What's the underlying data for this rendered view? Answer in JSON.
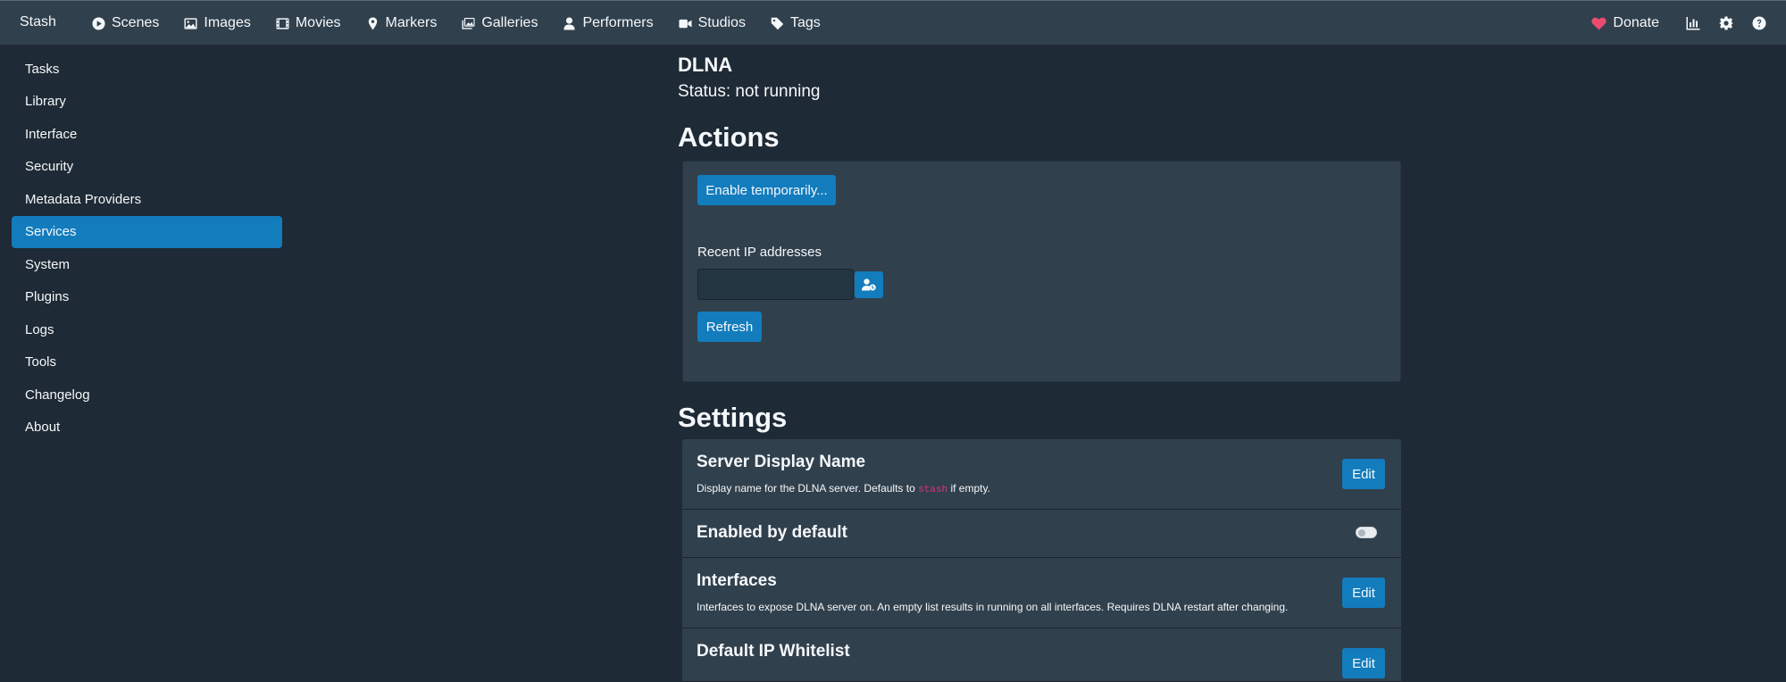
{
  "navbar": {
    "brand": "Stash",
    "items": [
      {
        "label": "Scenes",
        "icon": "play-circle-icon"
      },
      {
        "label": "Images",
        "icon": "image-icon"
      },
      {
        "label": "Movies",
        "icon": "film-icon"
      },
      {
        "label": "Markers",
        "icon": "map-marker-icon"
      },
      {
        "label": "Galleries",
        "icon": "images-icon"
      },
      {
        "label": "Performers",
        "icon": "user-icon"
      },
      {
        "label": "Studios",
        "icon": "video-camera-icon"
      },
      {
        "label": "Tags",
        "icon": "tag-icon"
      }
    ],
    "donate_label": "Donate",
    "right_icons": [
      "stats-chart-icon",
      "gear-icon",
      "help-icon"
    ]
  },
  "sidebar": {
    "items": [
      {
        "label": "Tasks"
      },
      {
        "label": "Library"
      },
      {
        "label": "Interface"
      },
      {
        "label": "Security"
      },
      {
        "label": "Metadata Providers"
      },
      {
        "label": "Services",
        "active": true
      },
      {
        "label": "System"
      },
      {
        "label": "Plugins"
      },
      {
        "label": "Logs"
      },
      {
        "label": "Tools"
      },
      {
        "label": "Changelog"
      },
      {
        "label": "About"
      }
    ]
  },
  "main": {
    "title": "DLNA",
    "status_label": "Status: not running",
    "actions_heading": "Actions",
    "enable_button": "Enable temporarily...",
    "recent_ip_label": "Recent IP addresses",
    "recent_ip_value": "",
    "refresh_button": "Refresh",
    "settings_heading": "Settings",
    "settings": [
      {
        "title": "Server Display Name",
        "desc_before": "Display name for the DLNA server. Defaults to ",
        "desc_code": "stash",
        "desc_after": " if empty.",
        "action": "Edit"
      },
      {
        "title": "Enabled by default",
        "toggle": false
      },
      {
        "title": "Interfaces",
        "desc": "Interfaces to expose DLNA server on. An empty list results in running on all interfaces. Requires DLNA restart after changing.",
        "action": "Edit"
      },
      {
        "title": "Default IP Whitelist",
        "action": "Edit"
      }
    ]
  },
  "colors": {
    "navbar_bg": "#30404d",
    "page_bg": "#1e2a35",
    "accent": "#137cbd",
    "heart": "#ea4c70"
  }
}
